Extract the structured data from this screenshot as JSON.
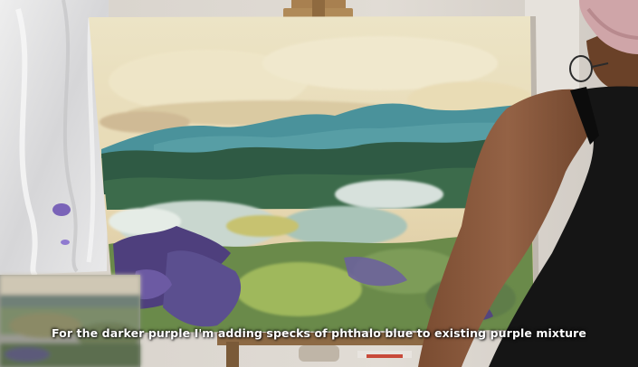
{
  "video": {
    "caption": "For the darker purple I'm adding specks of phthalo blue to existing purple mixture"
  },
  "scene": {
    "subject": "artist-painting-landscape-on-easel",
    "colors": {
      "wall": "#d9d4ce",
      "sky": "#e8dcb8",
      "teal_hills": "#3f8a93",
      "dark_green": "#2f5a44",
      "purple": "#5b4f8f",
      "shirt": "#151515",
      "skin": "#8a5a3c",
      "headwrap": "#cfa5a8"
    }
  }
}
